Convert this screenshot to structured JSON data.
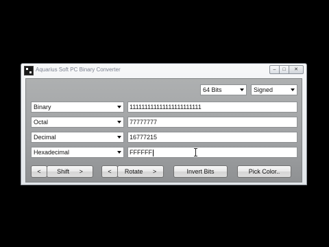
{
  "window": {
    "title": "Aquarius Soft PC Binary Converter",
    "controls": {
      "minimize": "–",
      "maximize": "□",
      "close": "✕"
    }
  },
  "options": {
    "bits_selected": "64 Bits",
    "sign_selected": "Signed"
  },
  "rows": [
    {
      "base": "Binary",
      "value": "111111111111111111111111"
    },
    {
      "base": "Octal",
      "value": "77777777"
    },
    {
      "base": "Decimal",
      "value": "16777215"
    },
    {
      "base": "Hexadecimal",
      "value": "FFFFFF"
    }
  ],
  "buttons": {
    "shift_left": "<",
    "shift": "Shift",
    "shift_right": ">",
    "rotate_left": "<",
    "rotate": "Rotate",
    "rotate_right": ">",
    "invert_bits": "Invert Bits",
    "pick_color": "Pick Color.."
  },
  "icons": {
    "app": "binary-converter-icon",
    "text_cursor": "i-beam-cursor-icon"
  }
}
